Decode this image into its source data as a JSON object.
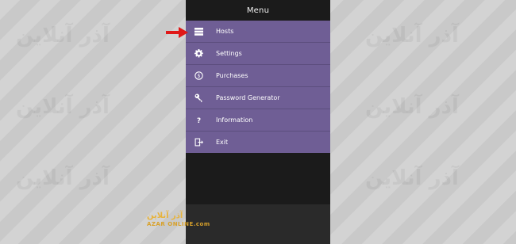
{
  "menu": {
    "title": "Menu",
    "items": [
      {
        "label": "Hosts",
        "icon": "server-icon"
      },
      {
        "label": "Settings",
        "icon": "gear-icon"
      },
      {
        "label": "Purchases",
        "icon": "dollar-icon"
      },
      {
        "label": "Password Generator",
        "icon": "key-icon"
      },
      {
        "label": "Information",
        "icon": "question-icon"
      },
      {
        "label": "Exit",
        "icon": "exit-icon"
      }
    ]
  },
  "watermark": {
    "brand": "آذر آنلاین",
    "site": "AZAR ONLINE.com"
  },
  "colors": {
    "accent": "#6f5e95",
    "arrow": "#e01818"
  }
}
